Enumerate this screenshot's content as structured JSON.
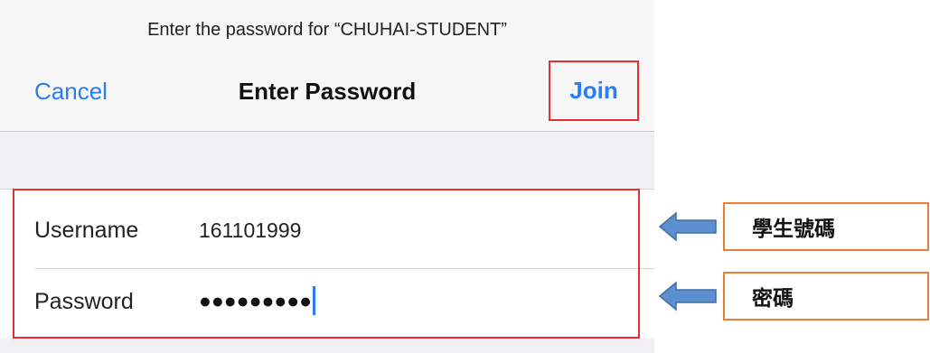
{
  "prompt": "Enter the password for “CHUHAI-STUDENT”",
  "nav": {
    "cancel_label": "Cancel",
    "title": "Enter Password",
    "join_label": "Join"
  },
  "form": {
    "username_label": "Username",
    "username_value": "161101999",
    "password_label": "Password",
    "password_value": "●●●●●●●●●"
  },
  "annotations": {
    "username_note": "學生號碼",
    "password_note": "密碼"
  },
  "colors": {
    "ios_blue": "#2a7df5",
    "highlight_red": "#e53030",
    "note_border_orange": "#ed7d31",
    "arrow_blue": "#5b8fd0"
  }
}
